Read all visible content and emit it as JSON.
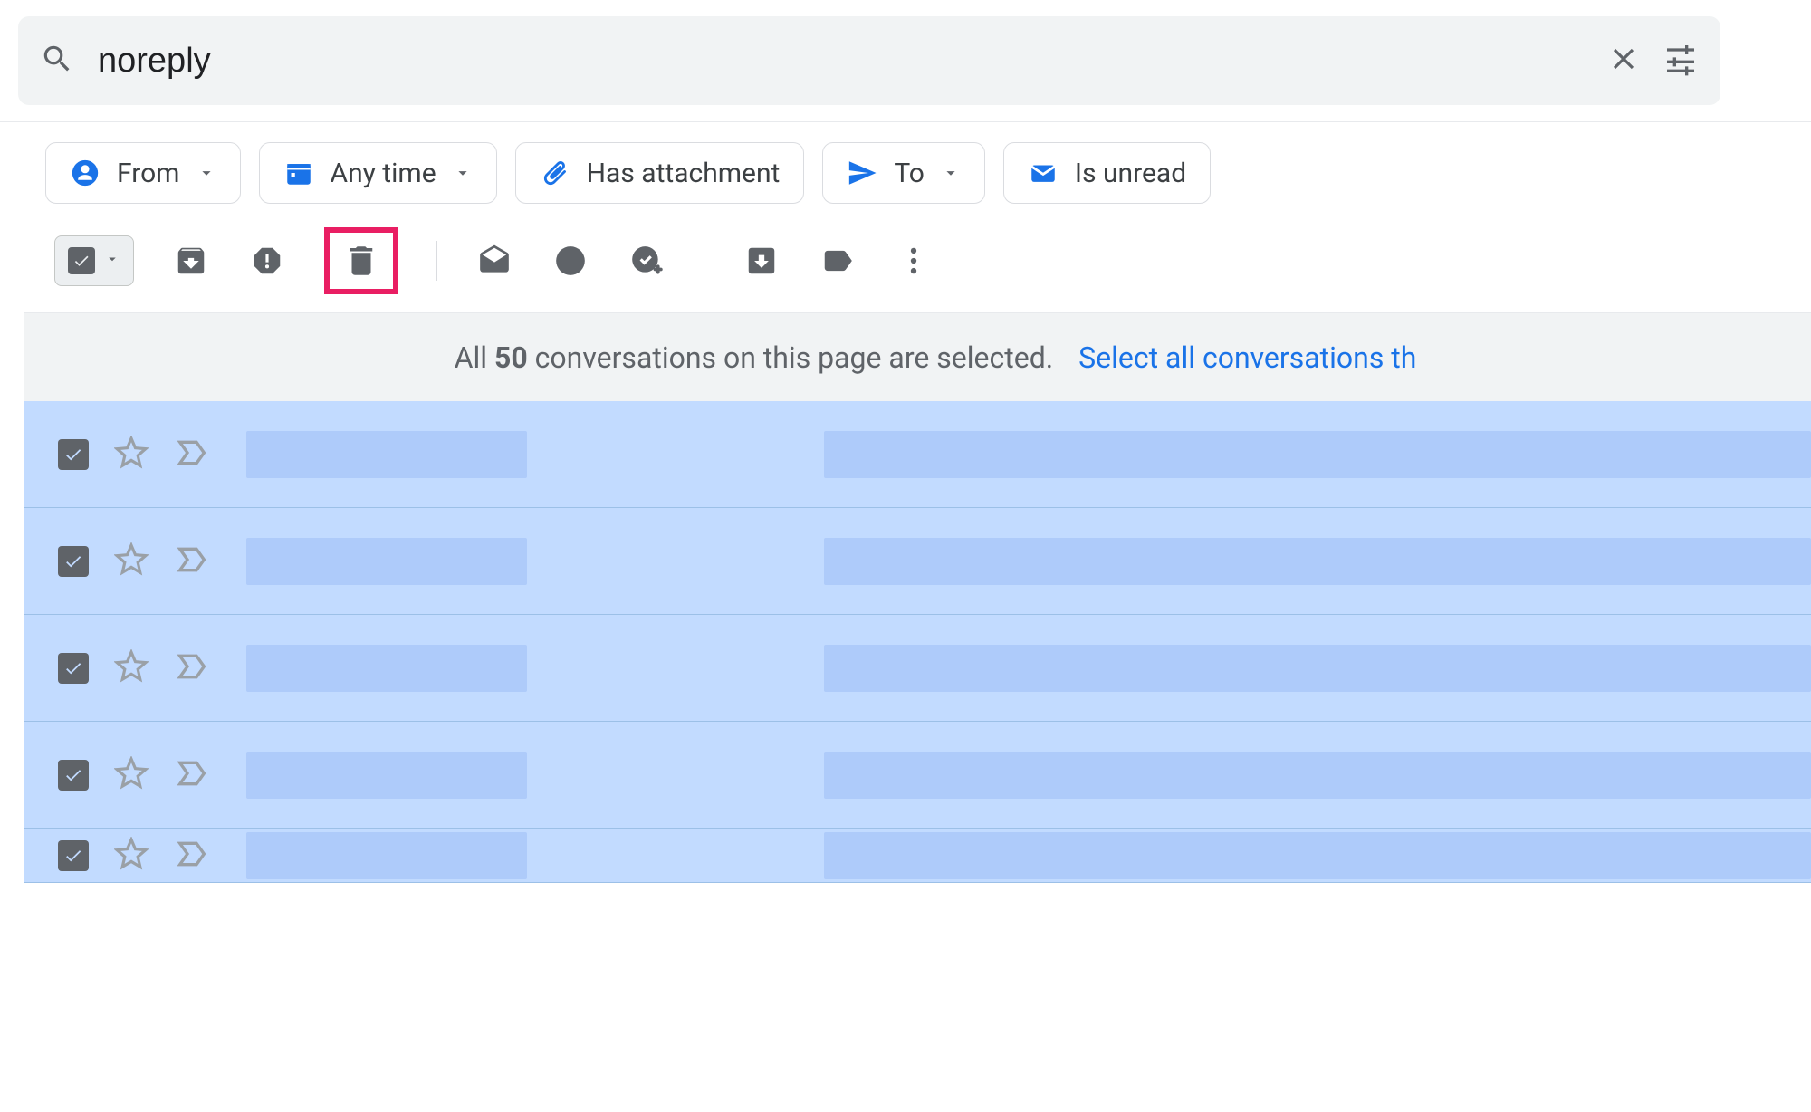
{
  "search": {
    "query": "noreply"
  },
  "filters": {
    "from": "From",
    "any_time": "Any time",
    "has_attachment": "Has attachment",
    "to": "To",
    "is_unread": "Is unread"
  },
  "selection_banner": {
    "text_prefix": "All ",
    "count": "50",
    "text_suffix": " conversations on this page are selected.",
    "select_all_link": "Select all conversations th"
  },
  "rows": [
    {
      "checked": true
    },
    {
      "checked": true
    },
    {
      "checked": true
    },
    {
      "checked": true
    },
    {
      "checked": true
    }
  ]
}
